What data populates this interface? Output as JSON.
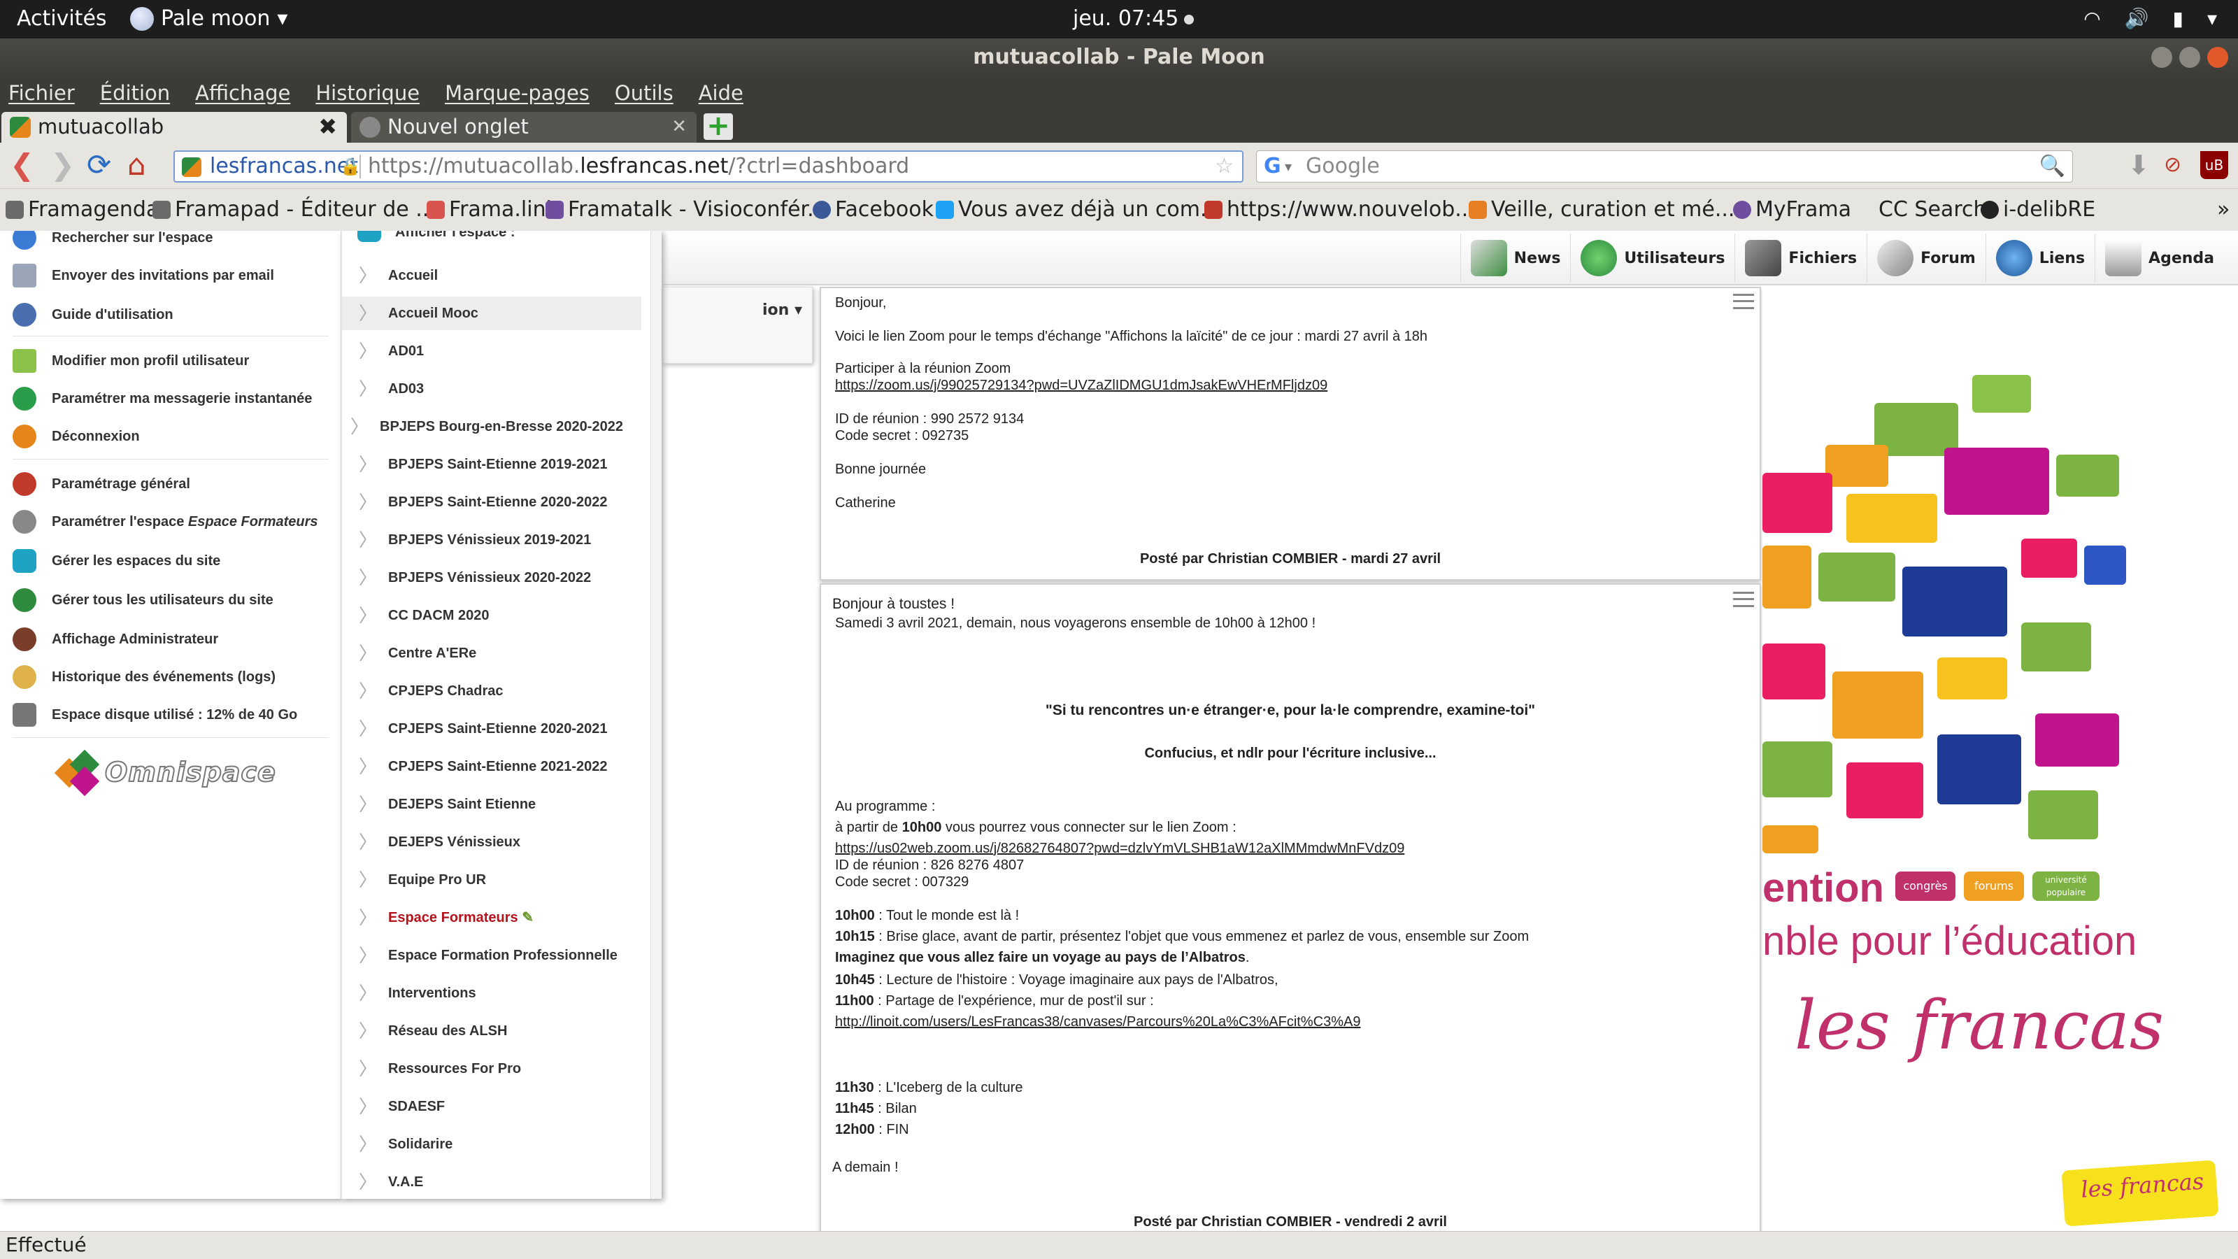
{
  "desktop": {
    "activities": "Activités",
    "app_name": "Pale moon",
    "clock": "jeu. 07:45"
  },
  "window": {
    "title": "mutuacollab - Pale Moon"
  },
  "menubar": [
    "Fichier",
    "Édition",
    "Affichage",
    "Historique",
    "Marque-pages",
    "Outils",
    "Aide"
  ],
  "tabs": [
    {
      "label": "mutuacollab",
      "active": true
    },
    {
      "label": "Nouvel onglet",
      "active": false
    }
  ],
  "navbar": {
    "site": "lesfrancas.net",
    "url_prefix": "https://mutuacollab.",
    "url_domain": "lesfrancas.net",
    "url_suffix": "/?ctrl=dashboard",
    "search_engine": "G",
    "search_placeholder": "Google"
  },
  "bookmarks": [
    {
      "label": "Framagenda",
      "color": "#6a6a6a"
    },
    {
      "label": "Framapad - Éditeur de ...",
      "color": "#6a6a6a"
    },
    {
      "label": "Frama.link",
      "color": "#d9534f"
    },
    {
      "label": "Framatalk - Visioconfér...",
      "color": "#6f4ea0"
    },
    {
      "label": "Facebook",
      "color": "#3b5998"
    },
    {
      "label": "Vous avez déjà un com...",
      "color": "#1da1f2"
    },
    {
      "label": "https://www.nouvelob...",
      "color": "#c0392b"
    },
    {
      "label": "Veille, curation et mé...",
      "color": "#e67e22"
    },
    {
      "label": "MyFrama",
      "color": "#6f4ea0"
    },
    {
      "label": "CC Search",
      "color": "#ffffff"
    },
    {
      "label": "i-delibRE",
      "color": "#222222"
    }
  ],
  "app_nav": [
    {
      "label": "News",
      "color": "#3e8e41"
    },
    {
      "label": "Utilisateurs",
      "color": "#2e8b3e"
    },
    {
      "label": "Fichiers",
      "color": "#555555"
    },
    {
      "label": "Forum",
      "color": "#888888"
    },
    {
      "label": "Liens",
      "color": "#e08a1e"
    },
    {
      "label": "Agenda",
      "color": "#777777"
    }
  ],
  "left_menu": {
    "items": [
      {
        "label": "Rechercher sur l'espace",
        "color": "#3a7bd5"
      },
      {
        "label": "Envoyer des invitations par email",
        "color": "#9aa6b8"
      },
      {
        "label": "Guide d'utilisation",
        "color": "#4a6fb0"
      },
      {
        "label": "Modifier mon profil utilisateur",
        "color": "#8bc34a"
      },
      {
        "label": "Paramétrer ma messagerie instantanée",
        "color": "#2a9d4a"
      },
      {
        "label": "Déconnexion",
        "color": "#e6861a"
      },
      {
        "label": "Paramétrage général",
        "color": "#c0392b"
      },
      {
        "label": "Paramétrer l'espace",
        "italic": "Espace Formateurs",
        "color": "#888888"
      },
      {
        "label": "Gérer les espaces du site",
        "color": "#1fa3c4"
      },
      {
        "label": "Gérer tous les utilisateurs du site",
        "color": "#2e8b3e"
      },
      {
        "label": "Affichage Administrateur",
        "color": "#7a3d2a"
      },
      {
        "label": "Historique des événements (logs)",
        "color": "#e0b24a"
      },
      {
        "label": "Espace disque utilisé : 12% de 40 Go",
        "color": "#777777"
      }
    ],
    "logo_text": "Omnispace"
  },
  "right_menu": {
    "header": "Afficher l'espace :",
    "items": [
      "Accueil",
      "Accueil Mooc",
      "AD01",
      "AD03",
      "BPJEPS Bourg-en-Bresse 2020-2022",
      "BPJEPS Saint-Etienne 2019-2021",
      "BPJEPS Saint-Etienne 2020-2022",
      "BPJEPS Vénissieux 2019-2021",
      "BPJEPS Vénissieux 2020-2022",
      "CC DACM 2020",
      "Centre A'ERe",
      "CPJEPS Chadrac",
      "CPJEPS Saint-Etienne 2020-2021",
      "CPJEPS Saint-Etienne 2021-2022",
      "DEJEPS Saint Etienne",
      "DEJEPS Vénissieux",
      "Equipe Pro UR",
      "Espace Formateurs",
      "Espace Formation Professionnelle",
      "Interventions",
      "Réseau des ALSH",
      "Ressources For Pro",
      "SDAESF",
      "Solidarire",
      "V.A.E"
    ],
    "highlighted": "Accueil Mooc",
    "current": "Espace Formateurs"
  },
  "mid_panel_text": "ion",
  "post1": {
    "lines": [
      "Bonjour,",
      "Voici le lien Zoom pour le temps d'échange \"Affichons la laïcité\" de ce jour :  mardi 27 avril à 18h",
      "Participer à la réunion Zoom",
      "https://zoom.us/j/99025729134?pwd=UVZaZlIDMGU1dmJsakEwVHErMFljdz09",
      "ID de réunion : 990 2572 9134",
      "Code secret : 092735",
      "Bonne journée",
      "Catherine"
    ],
    "footer": "Posté par Christian COMBIER - mardi 27 avril"
  },
  "post2": {
    "intro1": "Bonjour à toustes !",
    "intro2": "Samedi 3 avril 2021, demain, nous voyagerons ensemble de 10h00 à 12h00 !",
    "quote": "\"Si tu rencontres un·e étranger·e, pour la·le comprendre, examine-toi\"",
    "quote_author": "Confucius, et ndlr pour l'écriture inclusive...",
    "programme": "Au programme :",
    "from_prefix": "à partir de ",
    "from_time": "10h00",
    "from_suffix": "  vous pourrez vous connecter sur le lien Zoom :",
    "zoom_link": "https://us02web.zoom.us/j/82682764807?pwd=dzlvYmVLSHB1aW12aXlMMmdwMnFVdz09",
    "meeting_id": "ID de réunion : 826 8276 4807",
    "secret": "Code secret : 007329",
    "schedule": [
      {
        "time": "10h00",
        "text": " : Tout le monde est là !"
      },
      {
        "time": "10h15",
        "text": " : Brise glace, avant de partir, présentez l'objet que vous emmenez et parlez de vous, ensemble sur Zoom"
      },
      {
        "time": "",
        "text": "Imaginez que vous allez faire un voyage au pays de l’Albatros",
        "bold": true,
        "after": "."
      },
      {
        "time": "10h45",
        "text": " : Lecture de l'histoire : Voyage imaginaire aux pays de l'Albatros,"
      },
      {
        "time": "11h00",
        "text": " : Partage de l'expérience, mur de post'il sur :"
      }
    ],
    "linoit": "http://linoit.com/users/LesFrancas38/canvases/Parcours%20La%C3%AFcit%C3%A9",
    "schedule2": [
      {
        "time": "11h30",
        "text": " : L'Iceberg de la culture"
      },
      {
        "time": "11h45",
        "text": " : Bilan"
      },
      {
        "time": "12h00",
        "text": " : FIN"
      }
    ],
    "closing": "A demain !",
    "footer": "Posté par Christian COMBIER - vendredi 2 avril"
  },
  "banner": {
    "slogan1": "ention",
    "slogan2": "nble pour l’éducation",
    "pills": [
      {
        "label": "congrès",
        "color": "#c0306b"
      },
      {
        "label": "forums",
        "color": "#f0a020"
      },
      {
        "label": "université populaire",
        "color": "#7cb342"
      }
    ],
    "brand": "les francas",
    "foot_logo": "les francas"
  },
  "status": "Effectué"
}
